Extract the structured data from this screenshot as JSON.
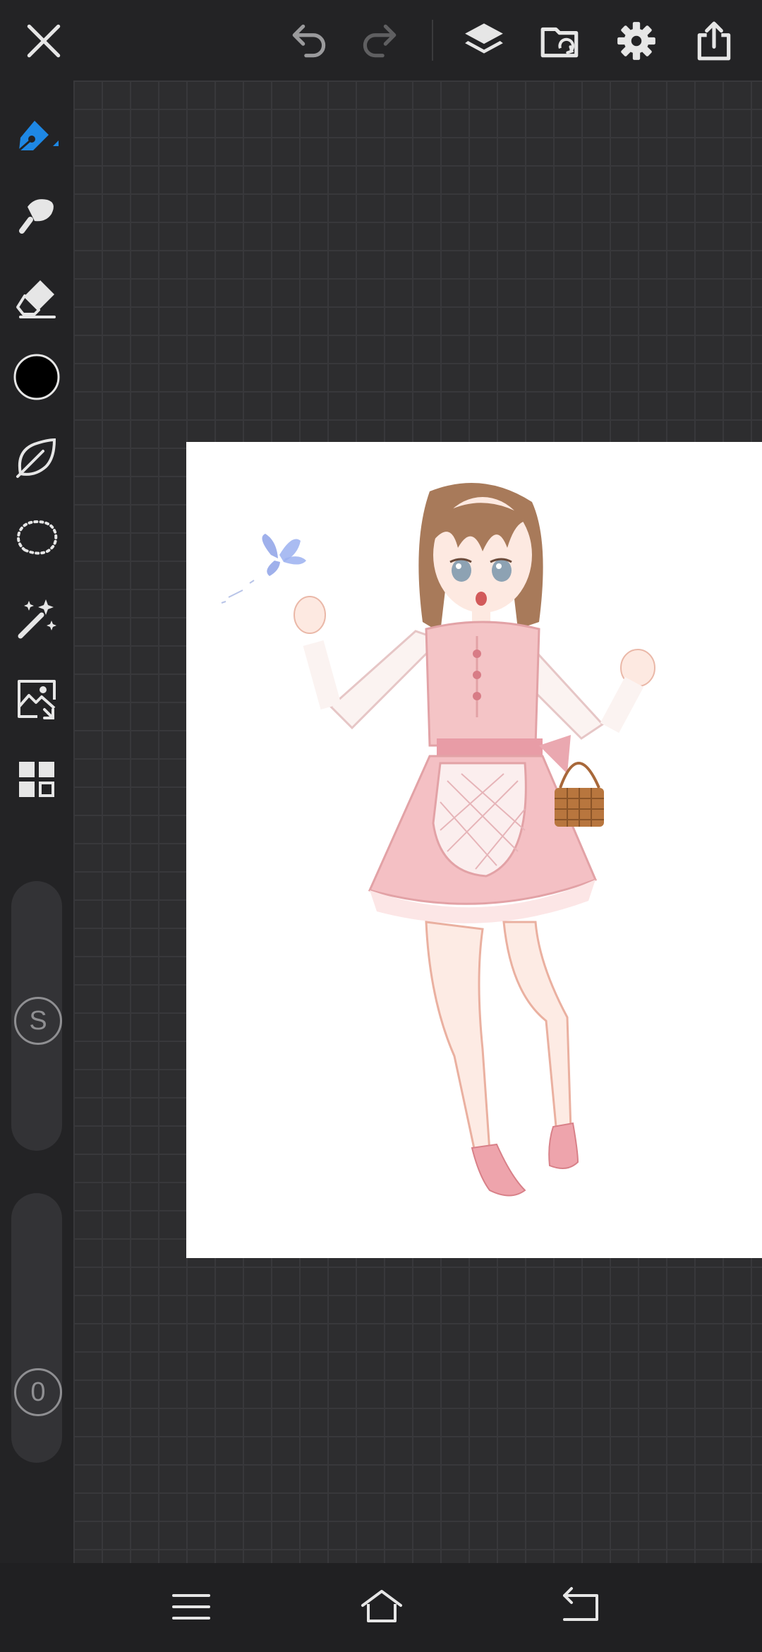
{
  "colors": {
    "accent": "#1e88e5",
    "icon": "#e6e6e6",
    "icon_disabled": "#6a6a6c",
    "current_color": "#000000"
  },
  "topbar": {
    "icons": [
      "close-icon",
      "undo-icon",
      "redo-icon",
      "layers-icon",
      "gallery-folder-icon",
      "settings-icon",
      "share-icon"
    ]
  },
  "sidebar": {
    "tools": [
      "pen-icon",
      "smudge-icon",
      "eraser-icon",
      "color-swatch",
      "leaf-brush-icon",
      "lasso-selection-icon",
      "magic-wand-icon",
      "image-transform-icon",
      "grid-panels-icon"
    ],
    "size_slider": {
      "label": "S"
    },
    "opacity_slider": {
      "label": "0"
    }
  },
  "navbar": {
    "icons": [
      "menu-icon",
      "home-icon",
      "back-icon"
    ]
  }
}
